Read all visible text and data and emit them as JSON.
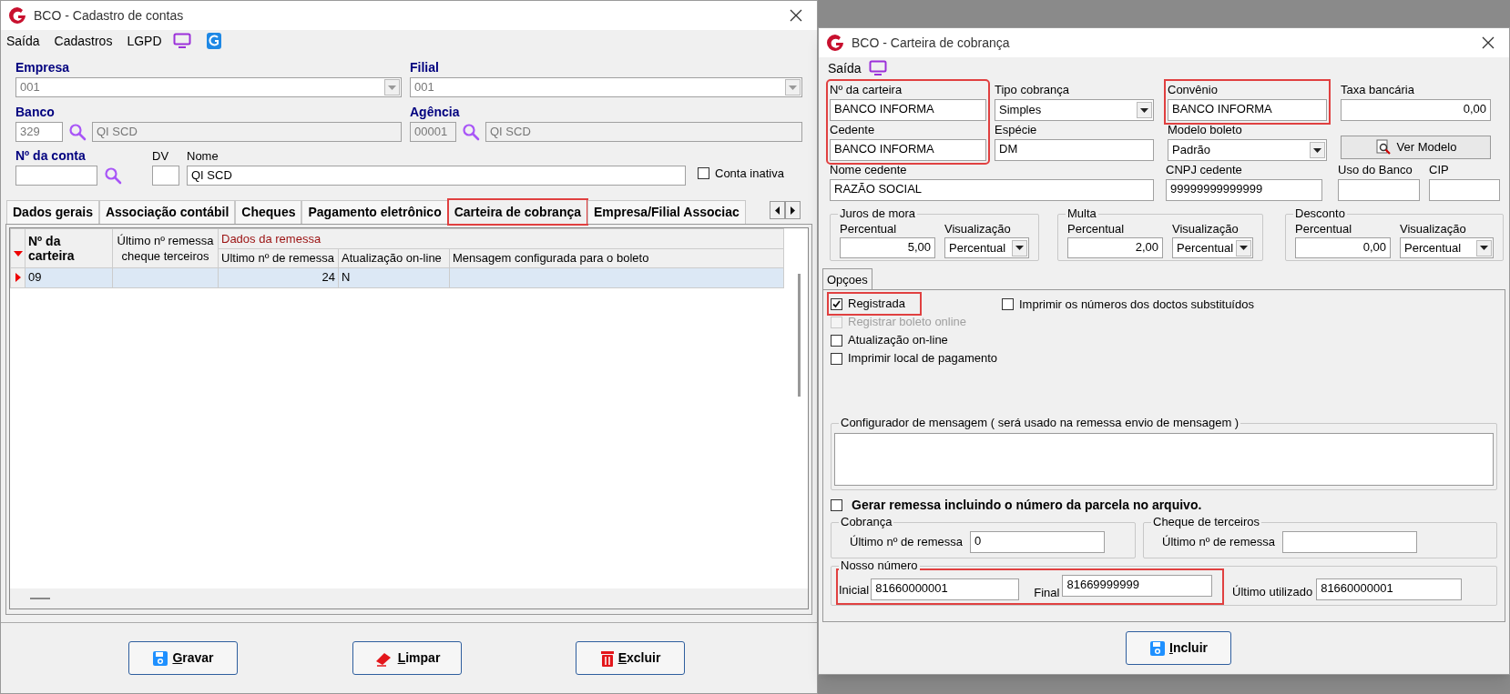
{
  "left_window": {
    "title": "BCO - Cadastro de contas",
    "menu": [
      "Saída",
      "Cadastros",
      "LGPD"
    ],
    "empresa": {
      "label": "Empresa",
      "value": "001"
    },
    "filial": {
      "label": "Filial",
      "value": "001"
    },
    "banco": {
      "label": "Banco",
      "code": "329",
      "name": "QI SCD"
    },
    "agencia": {
      "label": "Agência",
      "code": "00001",
      "name": "QI SCD"
    },
    "conta": {
      "label": "Nº da conta"
    },
    "dv": {
      "label": "DV"
    },
    "nome": {
      "label": "Nome",
      "value": "QI SCD"
    },
    "conta_inativa": {
      "label": "Conta inativa",
      "checked": false
    },
    "tabs": [
      {
        "label": "Dados gerais",
        "selected": false,
        "highlighted": false
      },
      {
        "label": "Associação contábil",
        "selected": false,
        "highlighted": false
      },
      {
        "label": "Cheques",
        "selected": false,
        "highlighted": false
      },
      {
        "label": "Pagamento eletrônico",
        "selected": false,
        "highlighted": false
      },
      {
        "label": "Carteira de cobrança",
        "selected": true,
        "highlighted": true
      },
      {
        "label": "Empresa/Filial Associac",
        "selected": false,
        "highlighted": false
      }
    ],
    "grid": {
      "col_carteira": "Nº da carteira",
      "col_cheque": "Último nº remessa cheque terceiros",
      "group_header": "Dados da remessa",
      "subcolumns": [
        "Ultimo nº de remessa",
        "Atualização on-line",
        "Mensagem configurada para o boleto"
      ],
      "rows": [
        {
          "carteira": "09",
          "ultimo": "24",
          "atualizacao": "N",
          "selected": true
        }
      ]
    },
    "buttons": [
      {
        "label": "Gravar"
      },
      {
        "label": "Limpar"
      },
      {
        "label": "Excluir"
      }
    ]
  },
  "right_window": {
    "title": "BCO - Carteira de cobrança",
    "menu": [
      "Saída"
    ],
    "columns": [
      {
        "highlighted": true,
        "fields": [
          {
            "kind": "text",
            "label": "Nº da carteira",
            "value": "BANCO INFORMA",
            "highlighted": false
          },
          {
            "kind": "text",
            "label": "Cedente",
            "value": "BANCO INFORMA",
            "highlighted": false
          }
        ]
      },
      {
        "highlighted": false,
        "fields": [
          {
            "kind": "select",
            "label": "Tipo cobrança",
            "value": "Simples",
            "highlighted": false
          },
          {
            "kind": "text",
            "label": "Espécie",
            "value": "DM",
            "highlighted": false
          }
        ]
      },
      {
        "highlighted": false,
        "fields": [
          {
            "kind": "text",
            "label": "Convênio",
            "value": "BANCO INFORMA",
            "highlighted": true
          },
          {
            "kind": "select",
            "label": "Modelo boleto",
            "value": "Padrão",
            "highlighted": false
          }
        ]
      },
      {
        "highlighted": false,
        "fields": [
          {
            "kind": "number",
            "label": "Taxa bancária",
            "value": "0,00",
            "highlighted": false
          },
          {
            "kind": "button",
            "label": "Ver Modelo",
            "highlighted": false
          }
        ]
      }
    ],
    "row3": [
      {
        "label": "Nome cedente",
        "value": "RAZÃO SOCIAL"
      },
      {
        "label": "CNPJ cedente",
        "value": "99999999999999"
      },
      {
        "label": "Uso do Banco"
      },
      {
        "label": "CIP"
      }
    ],
    "rates": [
      {
        "title": "Juros de mora",
        "percent_label": "Percentual",
        "percent": "5,00",
        "view_label": "Visualização",
        "view": "Percentual"
      },
      {
        "title": "Multa",
        "percent_label": "Percentual",
        "percent": "2,00",
        "view_label": "Visualização",
        "view": "Percentual"
      },
      {
        "title": "Desconto",
        "percent_label": "Percentual",
        "percent": "0,00",
        "view_label": "Visualização",
        "view": "Percentual"
      }
    ],
    "options_tab": {
      "label": "Opçoes",
      "selected": true
    },
    "options": [
      {
        "label": "Registrada",
        "checked": true,
        "disabled": false,
        "highlighted": true
      },
      {
        "label": "Registrar boleto online",
        "checked": false,
        "disabled": true,
        "highlighted": false
      },
      {
        "label": "Atualização on-line",
        "checked": false,
        "disabled": false,
        "highlighted": false
      },
      {
        "label": "Imprimir local de pagamento",
        "checked": false,
        "disabled": false,
        "highlighted": false
      }
    ],
    "option_right": {
      "label": "Imprimir os números dos doctos substituídos",
      "checked": false
    },
    "message_group": {
      "title": "Configurador de mensagem ( será usado na remessa envio de mensagem )"
    },
    "gerar": {
      "label": "Gerar remessa incluindo o número da parcela no arquivo.",
      "checked": false
    },
    "cobranca": {
      "title": "Cobrança",
      "label": "Último nº  de remessa",
      "value": "0"
    },
    "cheque": {
      "title": "Cheque de terceiros",
      "label": "Último nº  de remessa"
    },
    "nosso_numero": {
      "title": "Nosso número",
      "highlighted": true,
      "inicial_label": "Inicial",
      "inicial": "81660000001",
      "final_label": "Final",
      "final": "81669999999",
      "ultimo_label": "Último utilizado",
      "ultimo": "81660000001"
    },
    "button": {
      "label": "Incluir"
    }
  }
}
